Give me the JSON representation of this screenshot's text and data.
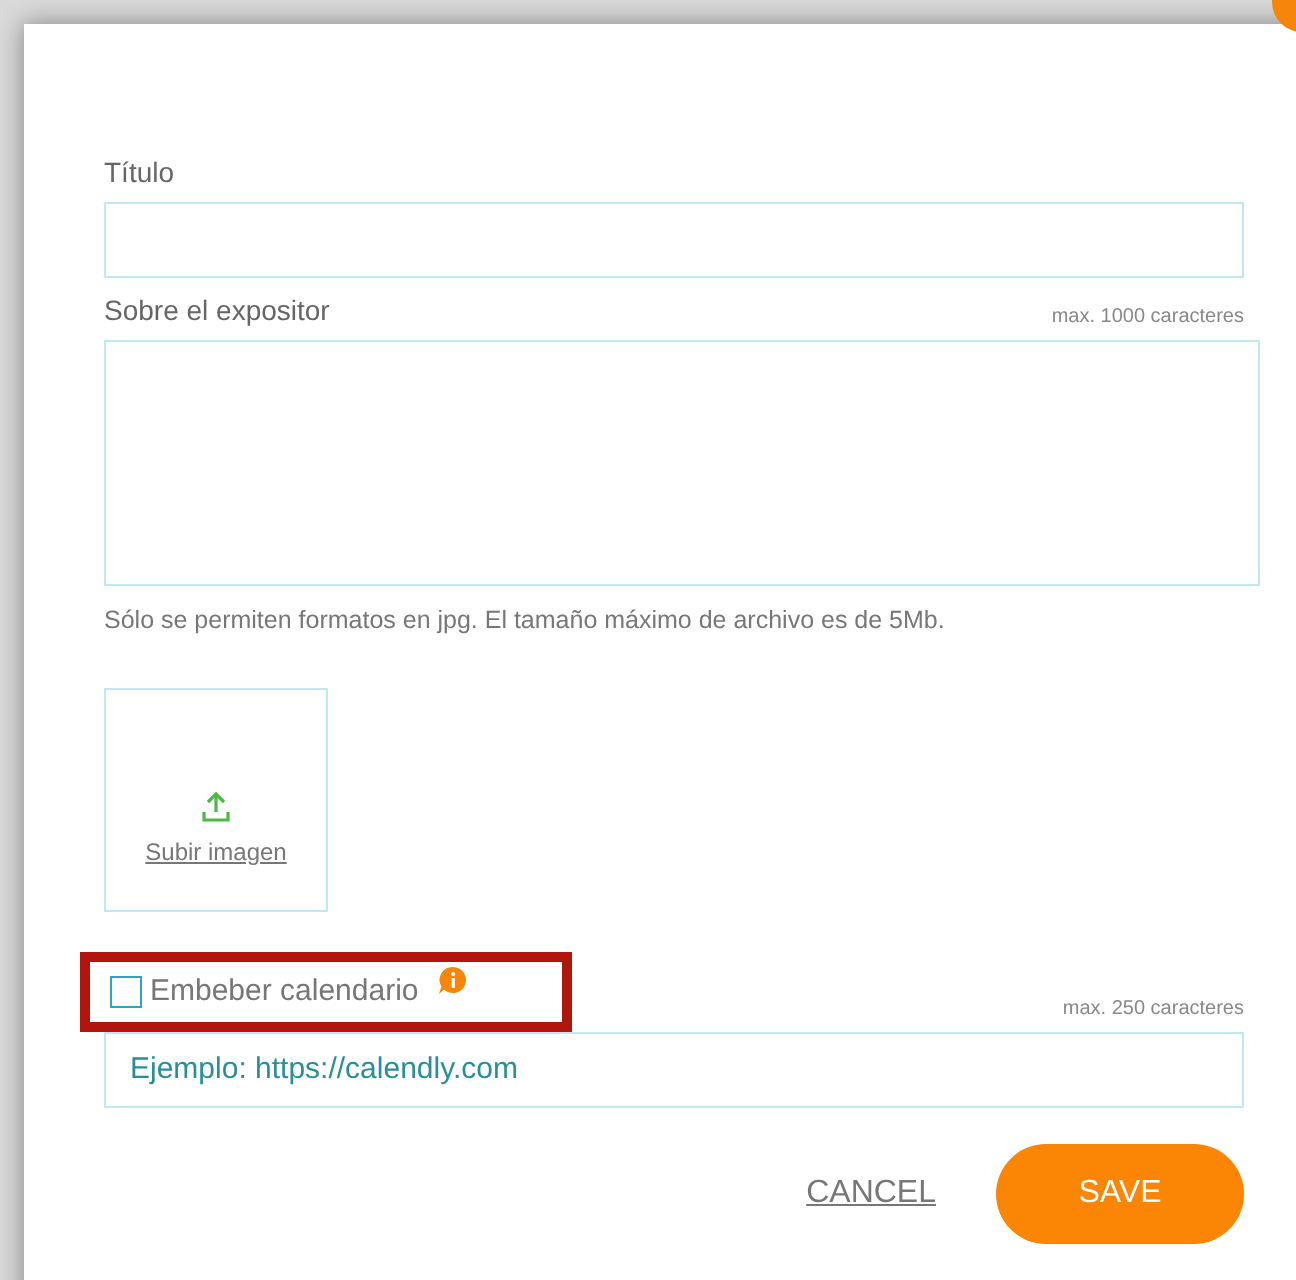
{
  "fields": [
    {
      "label": "Título",
      "kind": "input"
    },
    {
      "label": "Sobre el expositor",
      "limit": "max. 1000 caracteres",
      "kind": "textarea"
    }
  ],
  "upload": {
    "hint": "Sólo se permiten formatos en jpg. El tamaño máximo de archivo es de 5Mb.",
    "link": "Subir imagen"
  },
  "calendar": {
    "label": "Embeber calendario",
    "checked": false,
    "highlighted": true,
    "limit": "max. 250 caracteres",
    "placeholder": "Ejemplo: https://calendly.com"
  },
  "buttons": [
    {
      "label": "CANCEL",
      "kind": "link"
    },
    {
      "label": "SAVE",
      "kind": "primary"
    }
  ]
}
